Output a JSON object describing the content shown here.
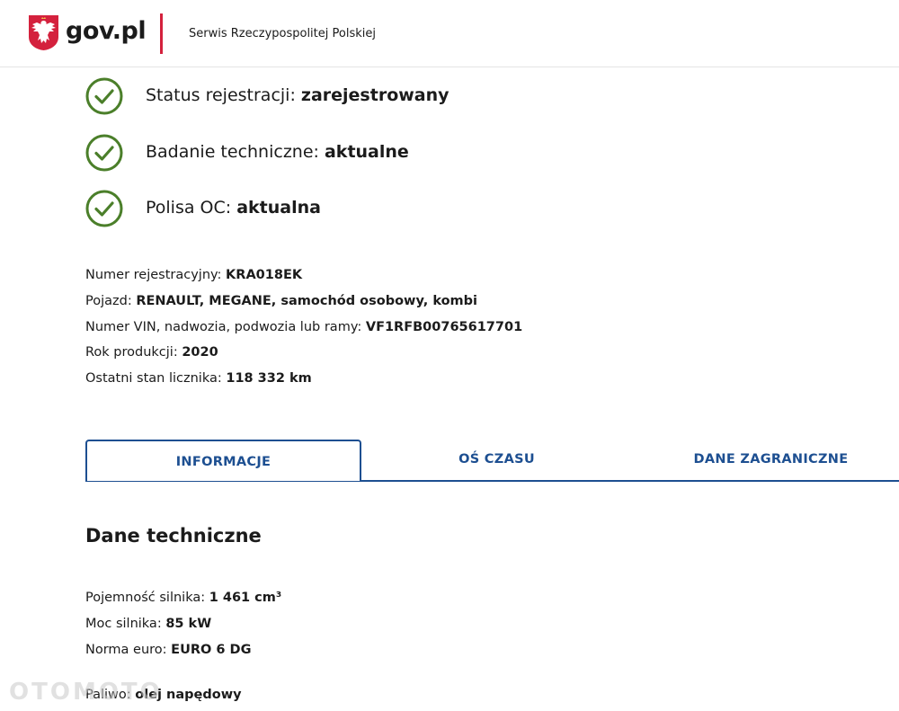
{
  "header": {
    "logo_text": "gov.pl",
    "service_name": "Serwis Rzeczypospolitej Polskiej",
    "accent_color": "#d4213d"
  },
  "statuses": [
    {
      "label": "Status rejestracji: ",
      "value": "zarejestrowany",
      "icon": "check-circle-icon"
    },
    {
      "label": "Badanie techniczne: ",
      "value": "aktualne",
      "icon": "check-circle-icon"
    },
    {
      "label": "Polisa OC: ",
      "value": "aktualna",
      "icon": "check-circle-icon"
    }
  ],
  "vehicle": {
    "reg_label": "Numer rejestracyjny: ",
    "reg_value": "KRA018EK",
    "vehicle_label": "Pojazd: ",
    "vehicle_value": "RENAULT, MEGANE, samochód osobowy, kombi",
    "vin_label": "Numer VIN, nadwozia, podwozia lub ramy: ",
    "vin_value": "VF1RFB00765617701",
    "year_label": "Rok produkcji: ",
    "year_value": "2020",
    "odometer_label": "Ostatni stan licznika: ",
    "odometer_value": "118 332 km"
  },
  "tabs": [
    {
      "label": "INFORMACJE",
      "active": true
    },
    {
      "label": "OŚ CZASU",
      "active": false
    },
    {
      "label": "DANE ZAGRANICZNE",
      "active": false
    }
  ],
  "technical": {
    "title": "Dane techniczne",
    "engine_label": "Pojemność silnika: ",
    "engine_value": "1 461 cm³",
    "power_label": "Moc silnika: ",
    "power_value": "85 kW",
    "euro_label": "Norma euro: ",
    "euro_value": "EURO 6 DG",
    "fuel_label": "Paliwo: ",
    "fuel_value": "olej napędowy"
  },
  "colors": {
    "check_green": "#4b7f2a",
    "tab_blue": "#1d4f91"
  },
  "watermark": "OTOMOTO"
}
